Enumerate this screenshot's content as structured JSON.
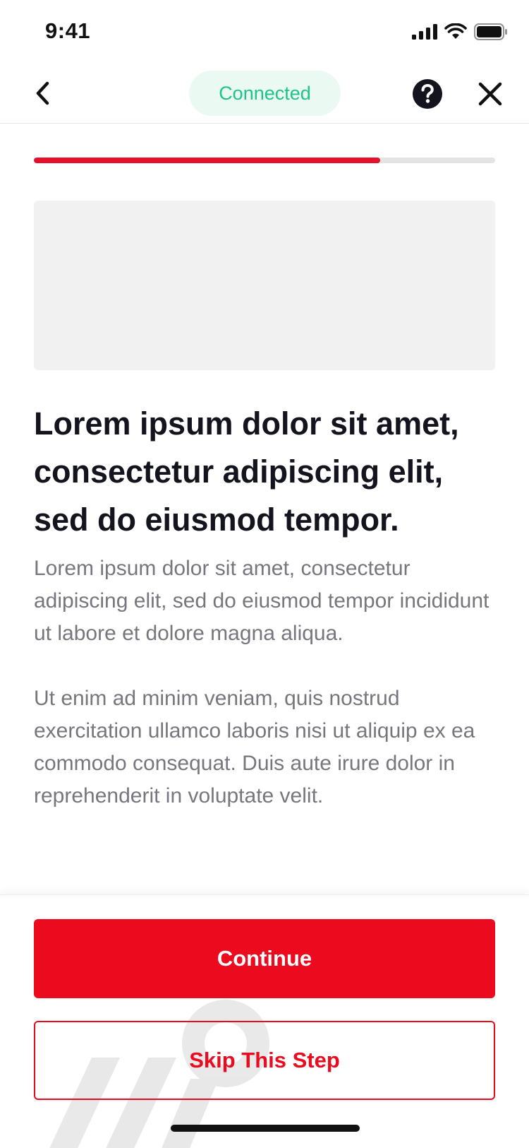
{
  "status_bar": {
    "time": "9:41",
    "icons": [
      "signal-icon",
      "wifi-icon",
      "battery-icon"
    ]
  },
  "nav": {
    "back_icon": "chevron-left-icon",
    "status_label": "Connected",
    "help_icon": "help-icon",
    "close_icon": "close-icon"
  },
  "progress": {
    "fraction": 0.75
  },
  "content": {
    "headline": "Lorem ipsum dolor sit amet, consectetur adipiscing elit, sed do eiusmod tempor.",
    "paragraphs": [
      "Lorem ipsum dolor sit amet, consectetur adipiscing elit, sed do eiusmod tempor incididunt ut labore et dolore magna aliqua.",
      "Ut enim ad minim veniam, quis nostrud exercitation ullamco laboris nisi ut aliquip ex ea commodo consequat. Duis aute irure dolor in reprehenderit in voluptate velit."
    ]
  },
  "actions": {
    "primary_label": "Continue",
    "secondary_label": "Skip This Step"
  },
  "colors": {
    "accent": "#eb0a1e",
    "connected_text": "#1fc48a",
    "connected_bg": "#eafaf3",
    "body_text": "#76767e",
    "heading_text": "#14141f"
  }
}
